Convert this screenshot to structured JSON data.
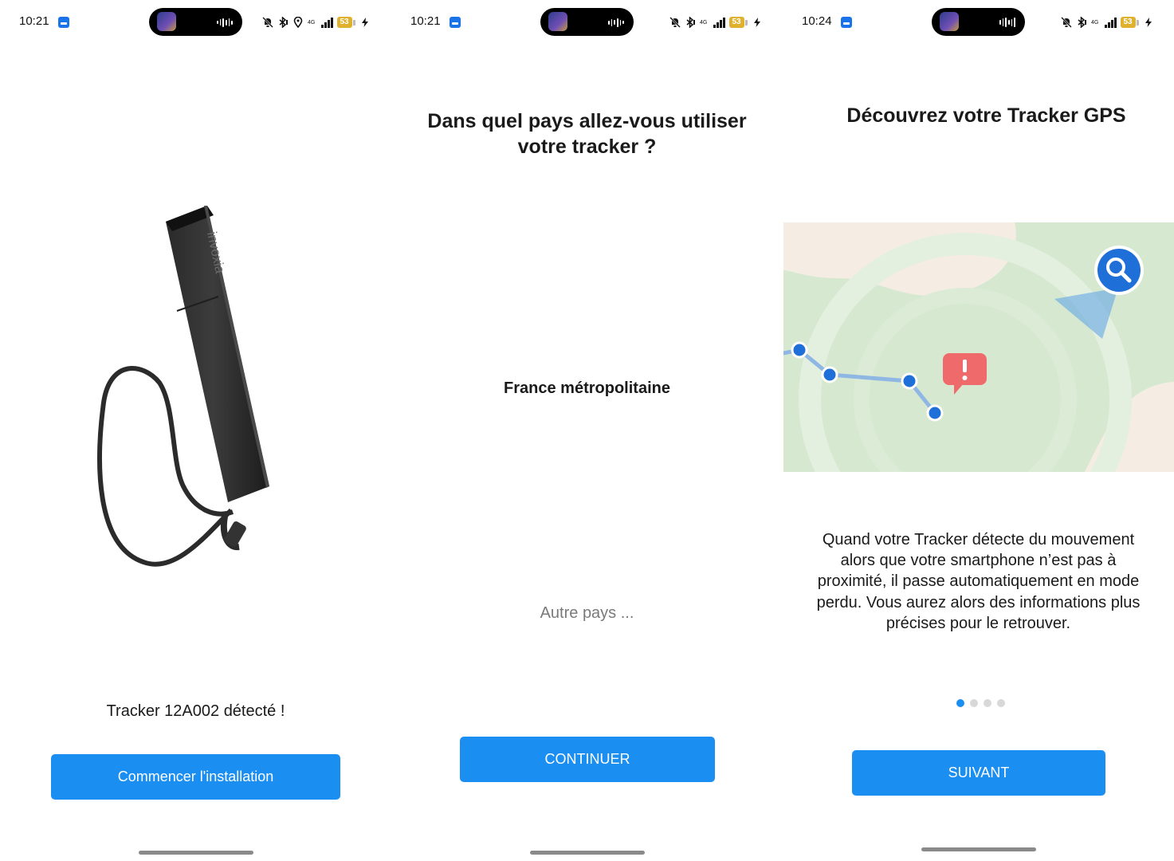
{
  "screens": [
    {
      "status": {
        "time": "10:21",
        "battery": "53",
        "network": "4G"
      },
      "device_message": "Tracker 12A002 détecté !",
      "device_brand": "invoxia",
      "primary_button": "Commencer l'installation"
    },
    {
      "status": {
        "time": "10:21",
        "battery": "53",
        "network": "4G"
      },
      "title": "Dans quel pays allez-vous utiliser votre tracker ?",
      "selected_country": "France métropolitaine",
      "other_country": "Autre pays ...",
      "primary_button": "CONTINUER"
    },
    {
      "status": {
        "time": "10:24",
        "battery": "53",
        "network": "4G"
      },
      "title": "Découvrez votre Tracker GPS",
      "description": "Quand votre Tracker détecte du mouvement alors que votre smartphone n’est pas à proximité, il passe automatiquement en mode perdu. Vous aurez alors des informations plus précises pour le retrouver.",
      "pager": {
        "total": 4,
        "active": 1
      },
      "primary_button": "SUIVANT"
    }
  ],
  "colors": {
    "accent": "#1b8ef2",
    "map_green": "#d6e9d0",
    "map_sand": "#f5ede4",
    "route_blue": "#1f6fd8",
    "alert_red": "#ef6b6b"
  },
  "icons": {
    "status_bar": [
      "mute-icon",
      "bluetooth-icon",
      "location-icon",
      "signal-icon",
      "battery-icon",
      "charging-icon"
    ],
    "map": [
      "search-icon",
      "alert-icon"
    ]
  }
}
